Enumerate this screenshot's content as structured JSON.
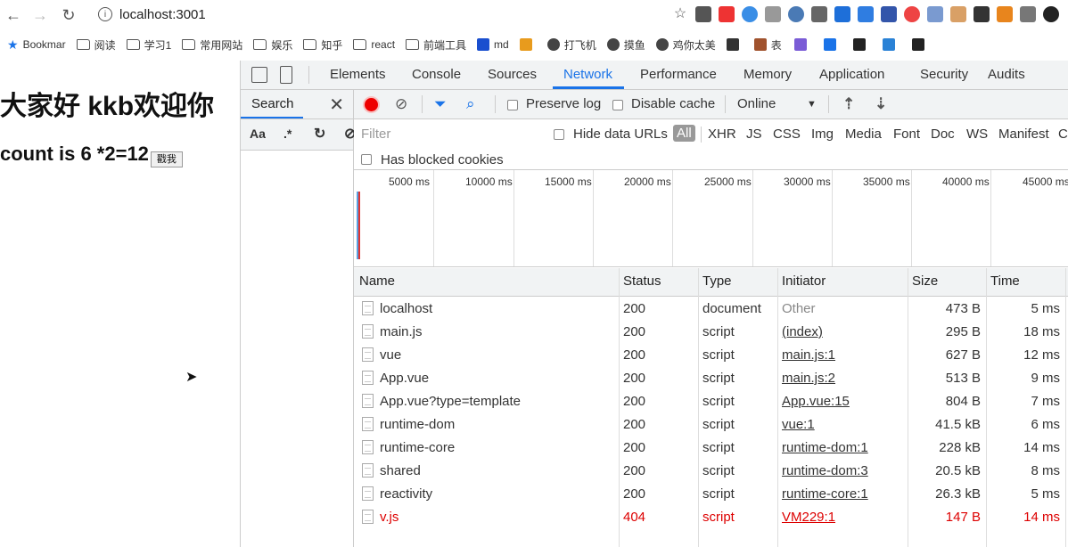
{
  "browser": {
    "url": "localhost:3001",
    "nav": {
      "back": "←",
      "forward": "→",
      "reload": "↻",
      "info": "i"
    },
    "bookmarks": [
      {
        "label": "Bookmar",
        "icon": "star-icon"
      },
      {
        "label": "阅读",
        "icon": "folder-icon"
      },
      {
        "label": "学习1",
        "icon": "folder-icon"
      },
      {
        "label": "常用网站",
        "icon": "folder-icon"
      },
      {
        "label": "娱乐",
        "icon": "folder-icon"
      },
      {
        "label": "知乎",
        "icon": "folder-icon"
      },
      {
        "label": "react",
        "icon": "folder-icon"
      },
      {
        "label": "前端工具",
        "icon": "folder-icon"
      },
      {
        "label": "md",
        "icon": "n-logo-icon"
      },
      {
        "label": "",
        "icon": "ph-logo-icon"
      },
      {
        "label": "打飞机",
        "icon": "globe-icon"
      },
      {
        "label": "摸鱼",
        "icon": "globe-icon"
      },
      {
        "label": "鸡你太美",
        "icon": "globe-icon"
      },
      {
        "label": "",
        "icon": "panda-icon"
      },
      {
        "label": "表",
        "icon": "avatar-icon"
      }
    ]
  },
  "page": {
    "title": "大家好 kkb欢迎你",
    "count_text": "count is 6 *2=12",
    "button_label": "戳我"
  },
  "devtools": {
    "tabs": [
      "Elements",
      "Console",
      "Sources",
      "Network",
      "Performance",
      "Memory",
      "Application",
      "Security",
      "Audits"
    ],
    "active_tab": "Network",
    "search": {
      "tab_label": "Search",
      "close": "✕",
      "tools": [
        "Aa",
        ".*",
        "↻",
        "⊘"
      ]
    },
    "toolbar": {
      "preserve_log": "Preserve log",
      "disable_cache": "Disable cache",
      "throttle": "Online",
      "throttle_arrow": "▼",
      "upload": "⇡",
      "download": "⇣"
    },
    "filter": {
      "placeholder": "Filter",
      "hide_data_urls": "Hide data URLs",
      "types": [
        "All",
        "XHR",
        "JS",
        "CSS",
        "Img",
        "Media",
        "Font",
        "Doc",
        "WS",
        "Manifest",
        "C"
      ],
      "blocked_cookies": "Has blocked cookies"
    },
    "timeline_ticks": [
      "5000 ms",
      "10000 ms",
      "15000 ms",
      "20000 ms",
      "25000 ms",
      "30000 ms",
      "35000 ms",
      "40000 ms",
      "45000 ms"
    ],
    "columns": [
      "Name",
      "Status",
      "Type",
      "Initiator",
      "Size",
      "Time"
    ],
    "rows": [
      {
        "name": "localhost",
        "status": "200",
        "type": "document",
        "initiator": "Other",
        "size": "473 B",
        "time": "5 ms"
      },
      {
        "name": "main.js",
        "status": "200",
        "type": "script",
        "initiator": "(index)",
        "size": "295 B",
        "time": "18 ms"
      },
      {
        "name": "vue",
        "status": "200",
        "type": "script",
        "initiator": "main.js:1",
        "size": "627 B",
        "time": "12 ms"
      },
      {
        "name": "App.vue",
        "status": "200",
        "type": "script",
        "initiator": "main.js:2",
        "size": "513 B",
        "time": "9 ms"
      },
      {
        "name": "App.vue?type=template",
        "status": "200",
        "type": "script",
        "initiator": "App.vue:15",
        "size": "804 B",
        "time": "7 ms"
      },
      {
        "name": "runtime-dom",
        "status": "200",
        "type": "script",
        "initiator": "vue:1",
        "size": "41.5 kB",
        "time": "6 ms"
      },
      {
        "name": "runtime-core",
        "status": "200",
        "type": "script",
        "initiator": "runtime-dom:1",
        "size": "228 kB",
        "time": "14 ms"
      },
      {
        "name": "shared",
        "status": "200",
        "type": "script",
        "initiator": "runtime-dom:3",
        "size": "20.5 kB",
        "time": "8 ms"
      },
      {
        "name": "reactivity",
        "status": "200",
        "type": "script",
        "initiator": "runtime-core:1",
        "size": "26.3 kB",
        "time": "5 ms"
      },
      {
        "name": "v.js",
        "status": "404",
        "type": "script",
        "initiator": "VM229:1",
        "size": "147 B",
        "time": "14 ms",
        "error": true
      }
    ]
  },
  "colors": {
    "accent": "#1a73e8",
    "error": "#d00000",
    "record": "#ee0000"
  }
}
